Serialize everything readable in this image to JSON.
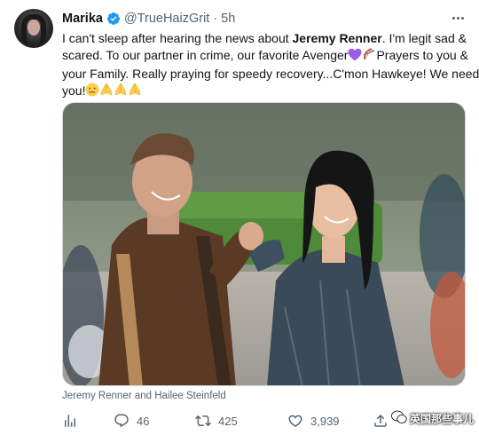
{
  "tweet": {
    "author_name": "Marika",
    "author_handle": "@TrueHaizGrit",
    "separator": "·",
    "timestamp": "5h",
    "text_lines": [
      [
        "I can't sleep after hearing the news about ",
        "Jeremy Renner",
        ". I'm legit sad &"
      ],
      [
        "scared. To our partner in crime, our favorite Avenger"
      ],
      [
        "your Family. Really praying for speedy recovery...C'mon Hawkeye! We need"
      ],
      [
        "you!"
      ]
    ],
    "line2_tail": "Prayers to you &",
    "media_caption": "Jeremy Renner and Hailee Steinfeld",
    "stats": {
      "replies": "46",
      "retweets": "425",
      "likes": "3,939"
    },
    "watermark": "英国那些事儿"
  },
  "icons": {
    "verified": "verified-badge-icon",
    "more": "more-options-icon",
    "analytics": "analytics-icon",
    "reply": "reply-icon",
    "retweet": "retweet-icon",
    "like": "heart-icon",
    "share": "share-icon"
  },
  "colors": {
    "verified_blue": "#1d9bf0",
    "secondary_text": "#536471",
    "primary_text": "#0f1419"
  }
}
